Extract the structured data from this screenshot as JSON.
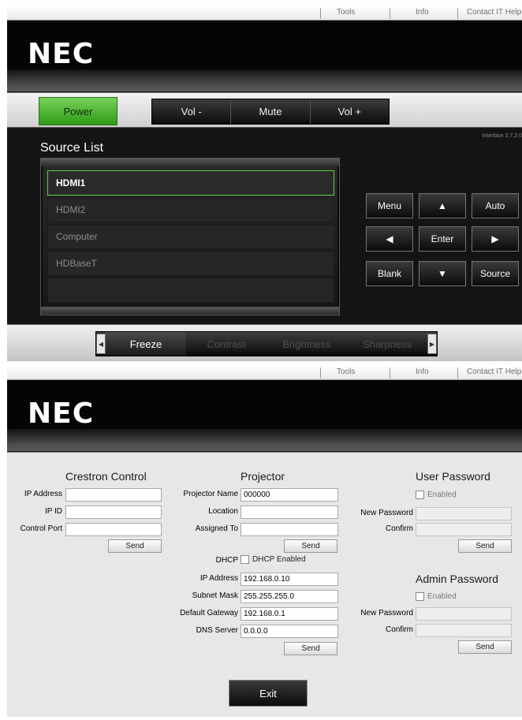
{
  "nav": {
    "tools": "Tools",
    "info": "Info",
    "contact": "Contact IT Help"
  },
  "brand": {
    "logo": "NEC"
  },
  "controls": {
    "power": "Power",
    "vol_down": "Vol -",
    "mute": "Mute",
    "vol_up": "Vol +"
  },
  "version": "Interface 2.7.2.0",
  "sources": {
    "title": "Source List",
    "items": [
      {
        "label": "HDMI1",
        "active": true
      },
      {
        "label": "HDMI2",
        "active": false
      },
      {
        "label": "Computer",
        "active": false
      },
      {
        "label": "HDBaseT",
        "active": false
      }
    ]
  },
  "pad": {
    "menu": "Menu",
    "auto": "Auto",
    "enter": "Enter",
    "blank": "Blank",
    "source": "Source",
    "up_icon": "▲",
    "down_icon": "▼",
    "left_icon": "◀",
    "right_icon": "▶"
  },
  "adjust": {
    "freeze": "Freeze",
    "contrast": "Contrast",
    "brightness": "Brightness",
    "sharpness": "Sharpness",
    "left_arrow": "◀",
    "right_arrow": "▶"
  },
  "crestron": {
    "title": "Crestron Control",
    "ip_label": "IP Address",
    "ip_value": "",
    "ipid_label": "IP ID",
    "ipid_value": "",
    "port_label": "Control Port",
    "port_value": "",
    "send": "Send"
  },
  "projector": {
    "title": "Projector",
    "name_label": "Projector Name",
    "name_value": "000000",
    "location_label": "Location",
    "location_value": "",
    "assigned_label": "Assigned To",
    "assigned_value": "",
    "send1": "Send",
    "dhcp_label": "DHCP",
    "dhcp_option": "DHCP Enabled",
    "ip_label": "IP Address",
    "ip_value": "192.168.0.10",
    "subnet_label": "Subnet Mask",
    "subnet_value": "255.255.255.0",
    "gateway_label": "Default Gateway",
    "gateway_value": "192.168.0.1",
    "dns_label": "DNS Server",
    "dns_value": "0.0.0.0",
    "send2": "Send"
  },
  "user_password": {
    "title": "User Password",
    "enabled": "Enabled",
    "new_label": "New Password",
    "confirm_label": "Confirm",
    "send": "Send"
  },
  "admin_password": {
    "title": "Admin Password",
    "enabled": "Enabled",
    "new_label": "New Password",
    "confirm_label": "Confirm",
    "send": "Send"
  },
  "exit": "Exit"
}
